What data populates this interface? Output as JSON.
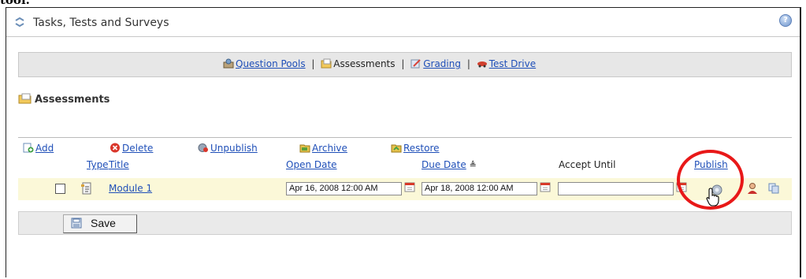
{
  "cut_top_text": "tool.",
  "header": {
    "title": "Tasks, Tests and Surveys",
    "help_glyph": "?"
  },
  "nav": {
    "question_pools": "Question Pools",
    "separator": "|",
    "assessments": "Assessments",
    "grading": "Grading",
    "test_drive": "Test Drive"
  },
  "section_title": "Assessments",
  "toolbar": {
    "add": "Add",
    "delete": "Delete",
    "unpublish": "Unpublish",
    "archive": "Archive",
    "restore": "Restore"
  },
  "columns": {
    "type": "Type",
    "title": "Title",
    "open_date": "Open Date",
    "due_date": "Due Date",
    "sort_glyph": "≜",
    "accept_until": "Accept Until",
    "publish": "Publish"
  },
  "rows": [
    {
      "checked": false,
      "title": "Module 1",
      "open_date": "Apr 16, 2008 12:00 AM",
      "due_date": "Apr 18, 2008 12:00 AM",
      "accept_until": ""
    }
  ],
  "footer": {
    "save_label": "Save"
  },
  "colors": {
    "link": "#1f4fb8",
    "row_highlight": "#fbf8d8",
    "annotation_circle": "#e81818"
  },
  "icons": [
    "refresh-icon",
    "help-icon",
    "question-pool-icon",
    "assessments-folder-icon",
    "grading-icon",
    "test-drive-icon",
    "add-icon",
    "delete-icon",
    "unpublish-icon",
    "archive-icon",
    "restore-icon",
    "calendar-icon",
    "publish-icon",
    "user-icon",
    "copy-icon",
    "save-icon",
    "hand-cursor-icon"
  ]
}
